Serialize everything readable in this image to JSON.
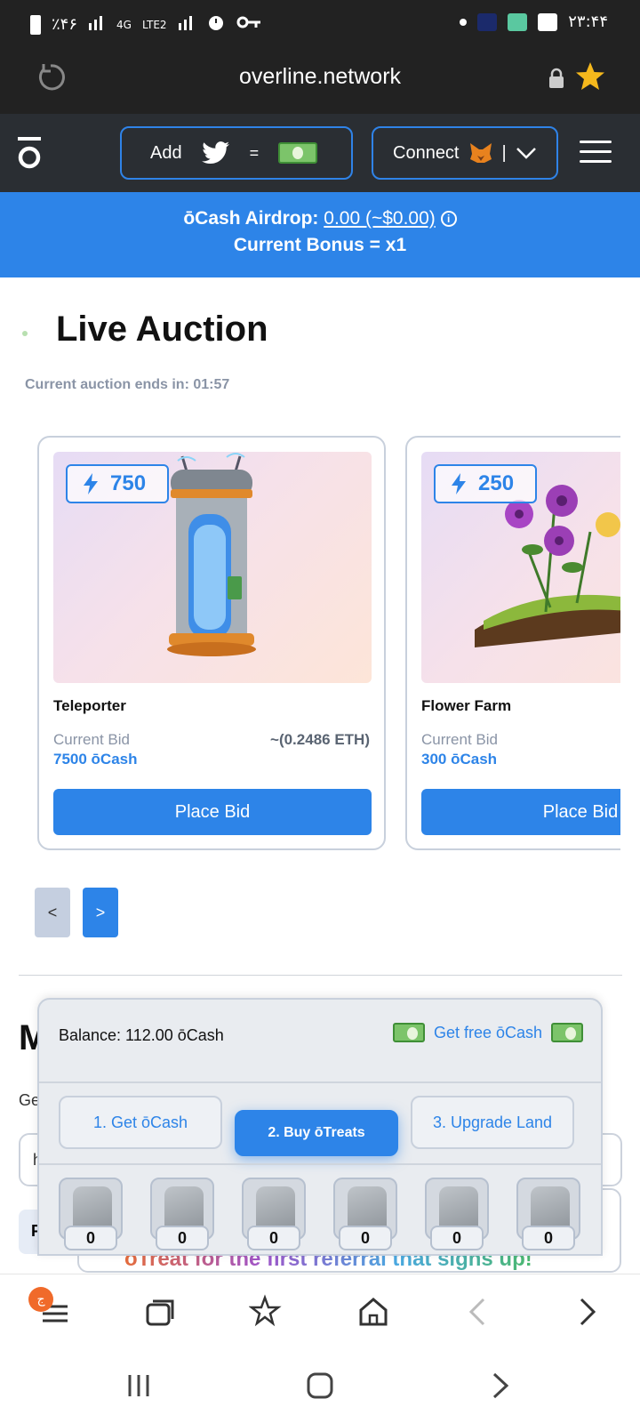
{
  "status_bar": {
    "left_text": "٪۴۶",
    "network": "4G",
    "lte": "LTE2",
    "time": "۲۳:۴۴"
  },
  "browser": {
    "url": "overline.network"
  },
  "header": {
    "add_label": "Add",
    "equals": "=",
    "connect_label": "Connect",
    "separator": "|"
  },
  "banner": {
    "airdrop_label": "ōCash Airdrop:",
    "airdrop_value": "0.00 (~$0.00)",
    "info": "i",
    "bonus": "Current Bonus = x1"
  },
  "auction": {
    "title": "Live Auction",
    "ends": "Current auction ends in: 01:57",
    "items": [
      {
        "energy": "750",
        "name": "Teleporter",
        "bid_label": "Current Bid",
        "bid_value": "7500 ōCash",
        "eth": "~(0.2486 ETH)",
        "button": "Place Bid"
      },
      {
        "energy": "250",
        "name": "Flower Farm",
        "bid_label": "Current Bid",
        "bid_value": "300 ōCash",
        "button": "Place Bid"
      }
    ],
    "prev": "<",
    "next": ">"
  },
  "background": {
    "heading_partial": "M",
    "text_partial": "Ge",
    "input_partial": "h",
    "tab_partial": "P",
    "referral_text": "ōTreat for the first referral that signs up!"
  },
  "panel": {
    "balance": "Balance: 112.00 ōCash",
    "free": "Get free ōCash",
    "tabs": [
      "1. Get ōCash",
      "2. Buy ōTreats",
      "3. Upgrade Land"
    ],
    "treat_counts": [
      "0",
      "0",
      "0",
      "0",
      "0",
      "0"
    ]
  },
  "bottom_nav": {
    "badge": "ج"
  },
  "colors": {
    "accent": "#2d84e8",
    "dark": "#2a2e33",
    "muted": "#8a94a6"
  }
}
